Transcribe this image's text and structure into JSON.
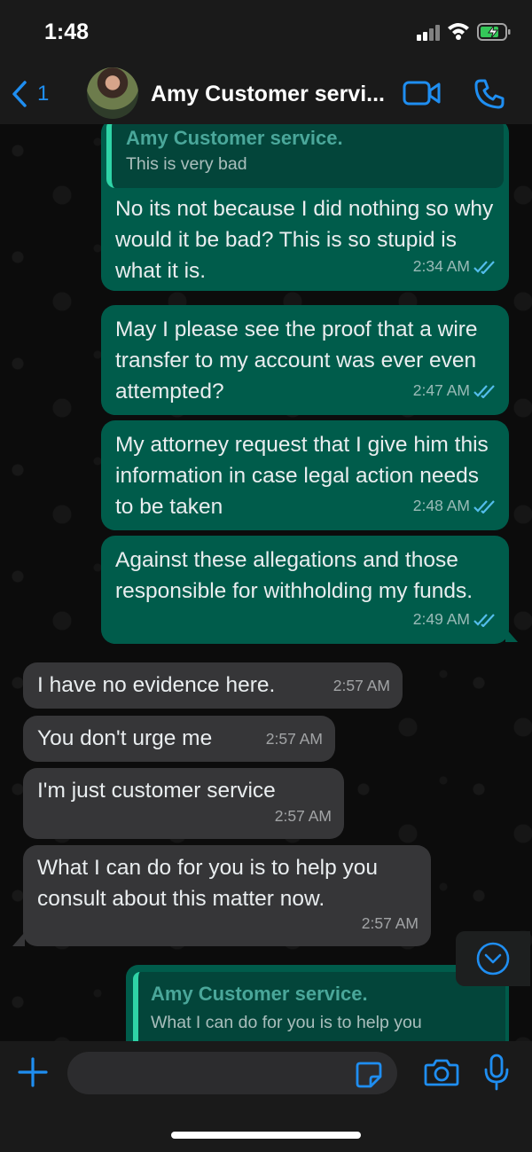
{
  "status_bar": {
    "time": "1:48"
  },
  "header": {
    "back_count": "1",
    "contact_name": "Amy Customer servi..."
  },
  "top_quote": {
    "name": "Amy Customer service.",
    "text": "This is very bad"
  },
  "messages": [
    {
      "direction": "out",
      "text": "No its not because I did nothing so why would it be bad? This is so stupid is what it is.",
      "time": "2:34 AM",
      "read": true
    },
    {
      "direction": "out",
      "text": "May I please see the proof that a wire transfer to my account was ever even attempted?",
      "time": "2:47 AM",
      "read": true
    },
    {
      "direction": "out",
      "text": "My attorney request that I give him this information in case legal action needs to be taken",
      "time": "2:48 AM",
      "read": true
    },
    {
      "direction": "out",
      "text": "Against these allegations and those responsible for withholding my funds.",
      "time": "2:49 AM",
      "read": true
    },
    {
      "direction": "in",
      "text": "I have no evidence here.",
      "time": "2:57 AM"
    },
    {
      "direction": "in",
      "text": "You don't urge me",
      "time": "2:57 AM"
    },
    {
      "direction": "in",
      "text": "I'm just customer service",
      "time": "2:57 AM"
    },
    {
      "direction": "in",
      "text": "What I can do for you is to help you consult about this matter now.",
      "time": "2:57 AM"
    }
  ],
  "reply_preview": {
    "name": "Amy Customer service.",
    "text": "What I can do for you is to help you"
  },
  "composer": {
    "placeholder": ""
  },
  "colors": {
    "outgoing_bubble": "#005c4b",
    "incoming_bubble": "#363638",
    "accent_blue": "#1f8ef1",
    "quote_bar": "#2fd4a7",
    "read_ticks": "#53bdeb"
  },
  "icons": [
    "back-chevron-icon",
    "video-call-icon",
    "phone-icon",
    "chevron-down-icon",
    "plus-icon",
    "sticker-icon",
    "camera-icon",
    "microphone-icon",
    "double-check-icon"
  ]
}
